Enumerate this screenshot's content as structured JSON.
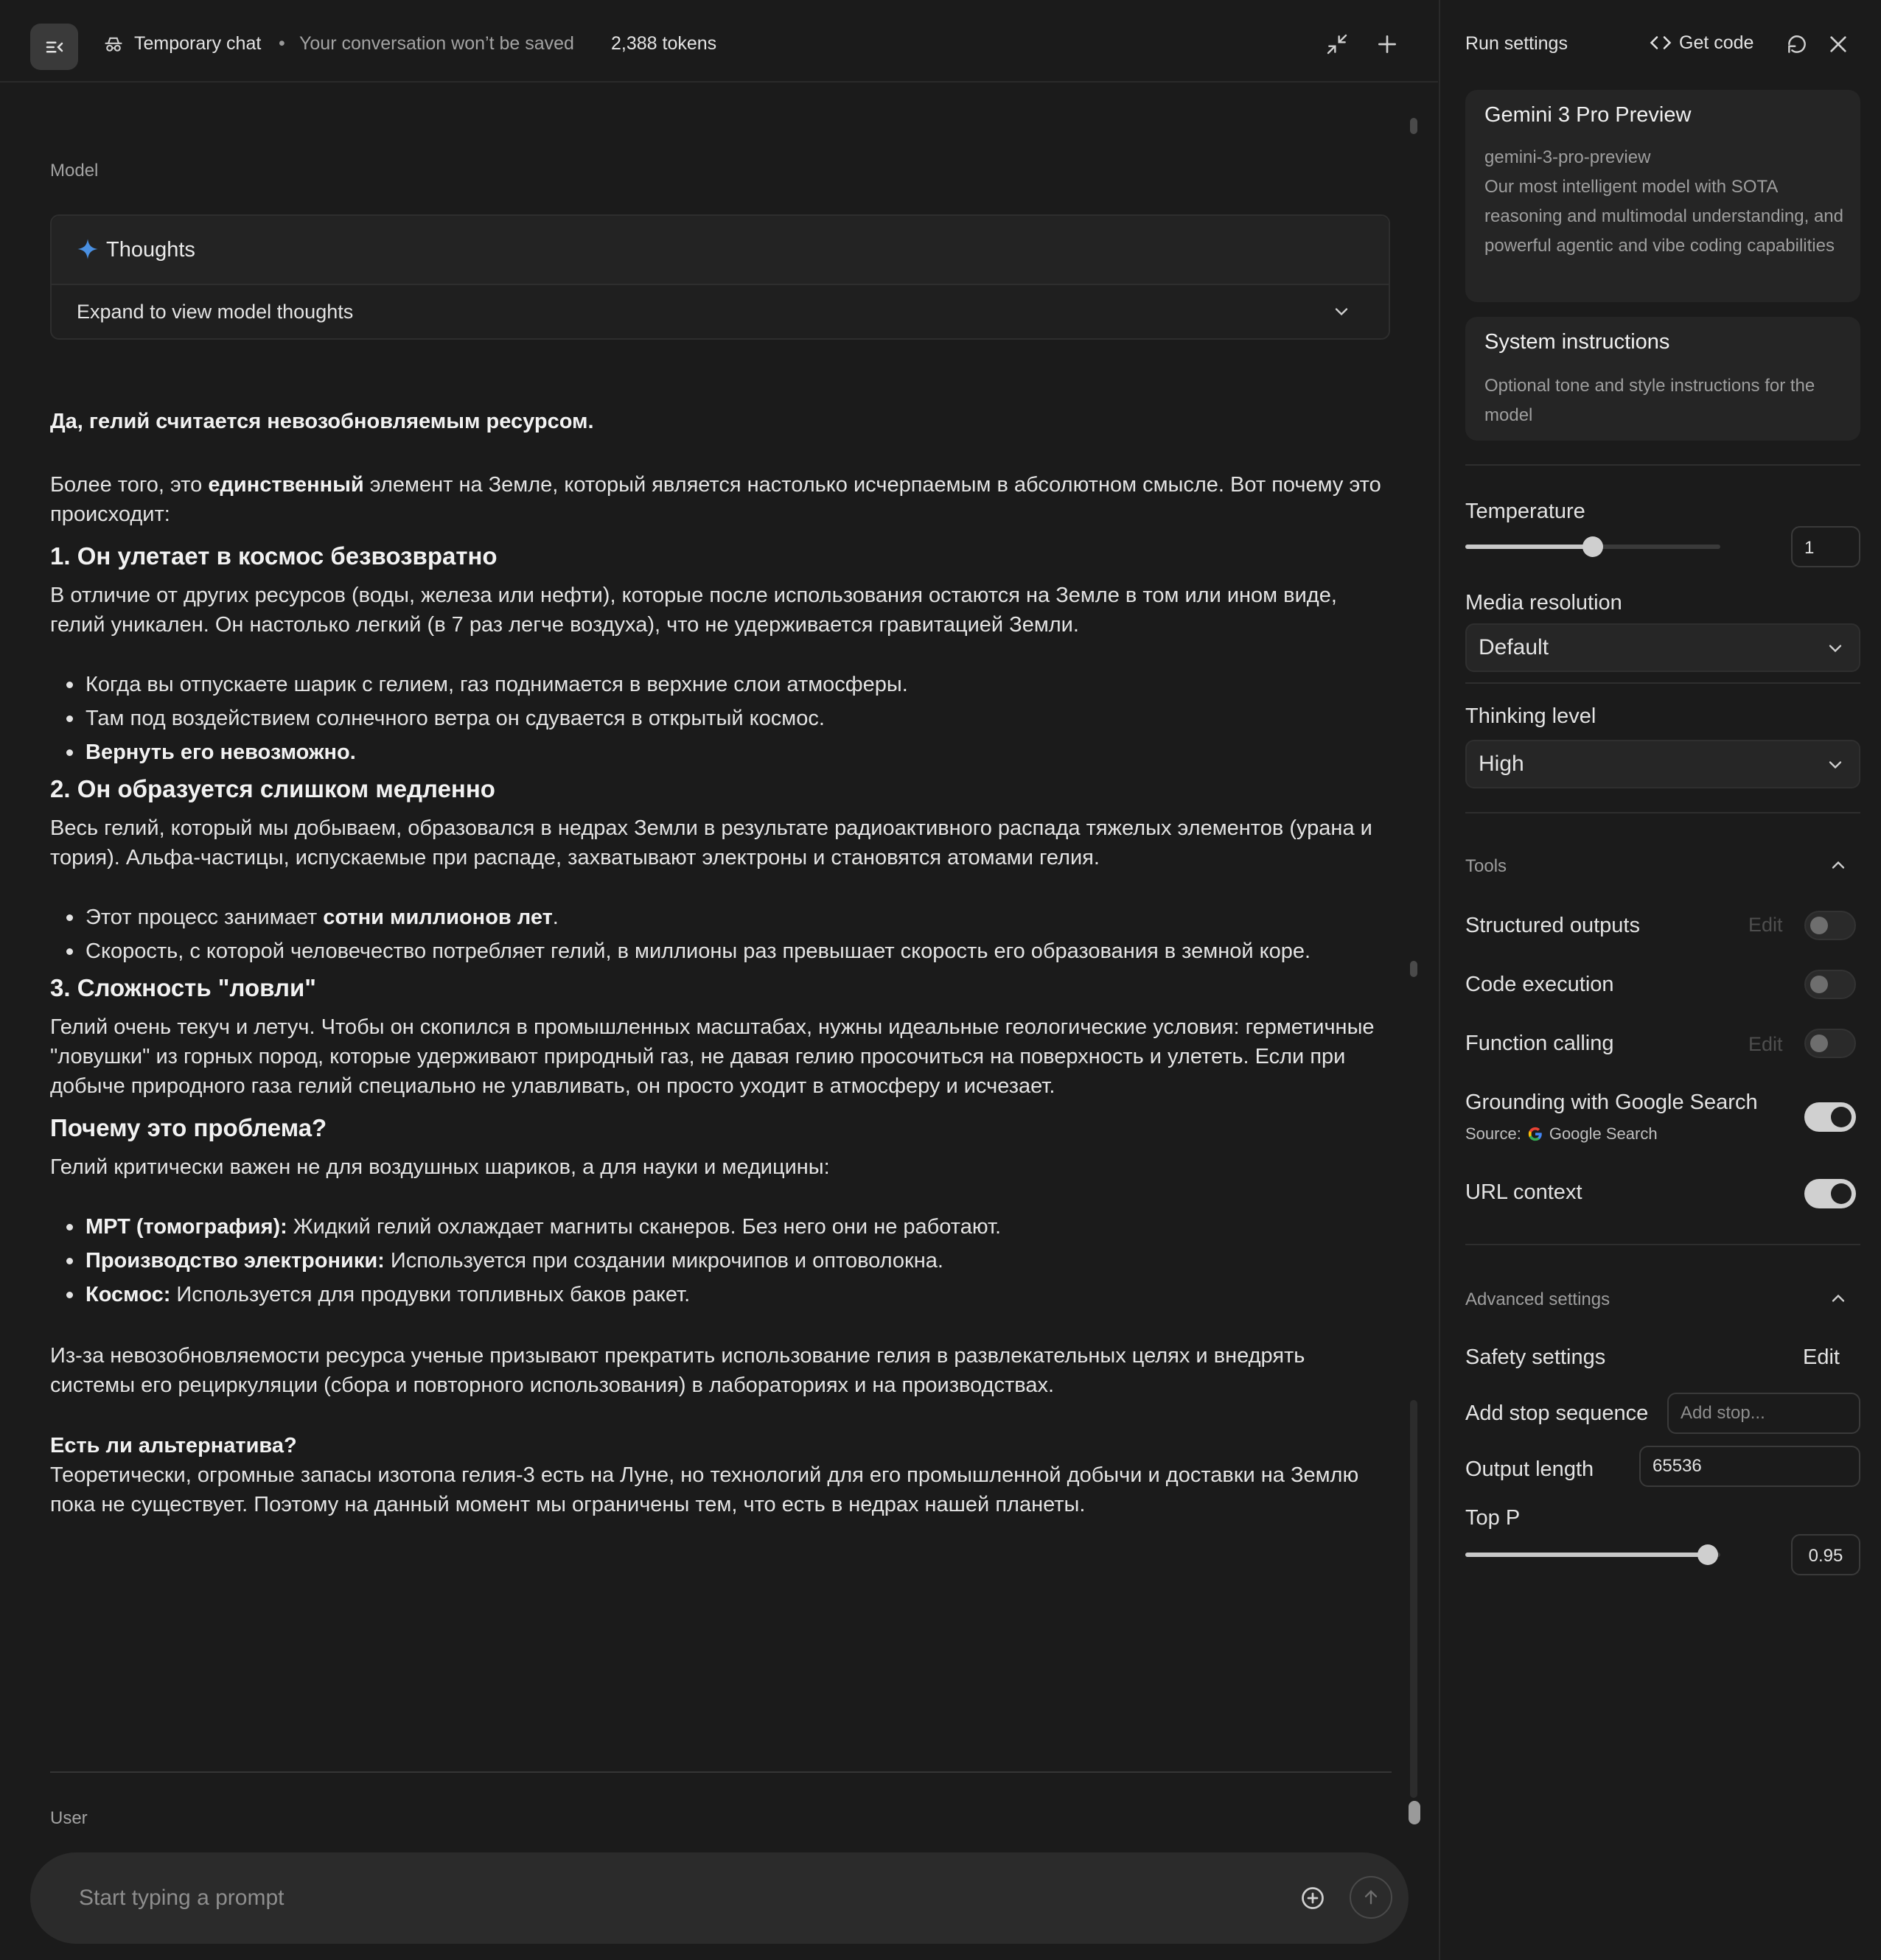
{
  "header": {
    "title": "Temporary chat",
    "separator": "•",
    "subtitle": "Your conversation won’t be saved",
    "tokens": "2,388 tokens"
  },
  "chat": {
    "model_label": "Model",
    "user_label": "User",
    "thoughts": {
      "title": "Thoughts",
      "expand_label": "Expand to view model thoughts"
    },
    "answer": {
      "p1": "Да, гелий считается невозобновляемым ресурсом.",
      "p2_a": "Более того, это ",
      "p2_b": "единственный",
      "p2_c": " элемент на Земле, который является настолько исчерпаемым в абсолютном смысле. Вот почему это происходит:",
      "h1": "1. Он улетает в космос безвозвратно",
      "p3": "В отличие от других ресурсов (воды, железа или нефти), которые после использования остаются на Земле в том или ином виде, гелий уникален. Он настолько легкий (в 7 раз легче воздуха), что не удерживается гравитацией Земли.",
      "l1_1": "Когда вы отпускаете шарик с гелием, газ поднимается в верхние слои атмосферы.",
      "l1_2": "Там под воздействием солнечного ветра он сдувается в открытый космос.",
      "l1_3": "Вернуть его невозможно.",
      "h2": "2. Он образуется слишком медленно",
      "p4": "Весь гелий, который мы добываем, образовался в недрах Земли в результате радиоактивного распада тяжелых элементов (урана и тория). Альфа-частицы, испускаемые при распаде, захватывают электроны и становятся атомами гелия.",
      "l2_1_a": "Этот процесс занимает ",
      "l2_1_b": "сотни миллионов лет",
      "l2_1_c": ".",
      "l2_2": "Скорость, с которой человечество потребляет гелий, в миллионы раз превышает скорость его образования в земной коре.",
      "h3": "3. Сложность \"ловли\"",
      "p5": "Гелий очень текуч и летуч. Чтобы он скопился в промышленных масштабах, нужны идеальные геологические условия: герметичные \"ловушки\" из горных пород, которые удерживают природный газ, не давая гелию просочиться на поверхность и улететь. Если при добыче природного газа гелий специально не улавливать, он просто уходит в атмосферу и исчезает.",
      "h4": "Почему это проблема?",
      "p6": "Гелий критически важен не для воздушных шариков, а для науки и медицины:",
      "l3_1_b": "МРТ (томография):",
      "l3_1_t": " Жидкий гелий охлаждает магниты сканеров. Без него они не работают.",
      "l3_2_b": "Производство электроники:",
      "l3_2_t": " Используется при создании микрочипов и оптоволокна.",
      "l3_3_b": "Космос:",
      "l3_3_t": " Используется для продувки топливных баков ракет.",
      "p7": "Из-за невозобновляемости ресурса ученые призывают прекратить использование гелия в развлекательных целях и внедрять системы его рециркуляции (сбора и повторного использования) в лабораториях и на производствах.",
      "p8_b": "Есть ли альтернатива?",
      "p8": "Теоретически, огромные запасы изотопа гелия-3 есть на Луне, но технологий для его промышленной добычи и доставки на Землю пока не существует. Поэтому на данный момент мы ограничены тем, что есть в недрах нашей планеты."
    },
    "prompt_placeholder": "Start typing a prompt"
  },
  "settings": {
    "title": "Run settings",
    "get_code": "Get code",
    "model": {
      "name": "Gemini 3 Pro Preview",
      "id": "gemini-3-pro-preview",
      "description": "Our most intelligent model with SOTA reasoning and multimodal understanding, and powerful agentic and vibe coding capabilities"
    },
    "system": {
      "title": "System instructions",
      "description": "Optional tone and style instructions for the model"
    },
    "temperature": {
      "label": "Temperature",
      "value": "1",
      "fraction": 0.5
    },
    "media_resolution": {
      "label": "Media resolution",
      "value": "Default"
    },
    "thinking_level": {
      "label": "Thinking level",
      "value": "High"
    },
    "tools": {
      "label": "Tools",
      "structured_outputs": "Structured outputs",
      "code_execution": "Code execution",
      "function_calling": "Function calling",
      "grounding": "Grounding with Google Search",
      "source_label": "Source:",
      "source_value": "Google Search",
      "url_context": "URL context",
      "edit": "Edit"
    },
    "advanced": {
      "label": "Advanced settings",
      "safety": "Safety settings",
      "safety_edit": "Edit",
      "stop_label": "Add stop sequence",
      "stop_placeholder": "Add stop...",
      "output_label": "Output length",
      "output_value": "65536",
      "topp_label": "Top P",
      "topp_value": "0.95",
      "topp_fraction": 0.95
    }
  },
  "colors": {
    "background": "#1b1b1b",
    "accent_spark": "#4a90e2",
    "toggle_on": "#d0d0d0"
  }
}
